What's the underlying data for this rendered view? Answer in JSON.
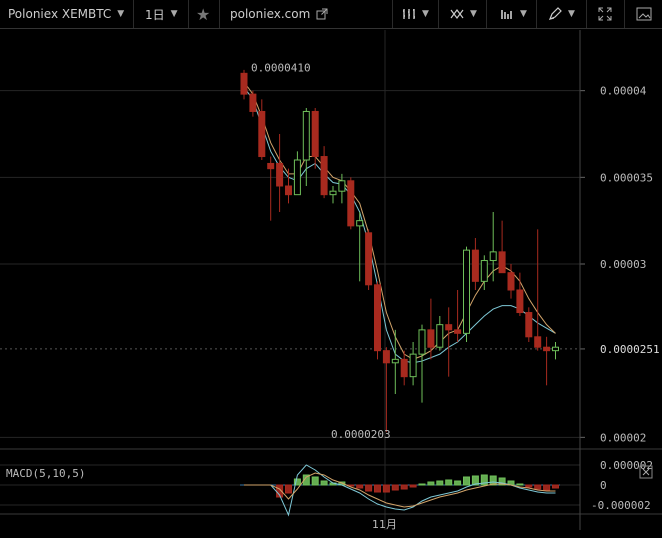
{
  "toolbar": {
    "symbol": "Poloniex XEMBTC",
    "interval": "1日",
    "source_link": "poloniex.com",
    "icons": [
      "star-icon",
      "external-link-icon",
      "bar-style-icon",
      "indicators-icon",
      "compare-icon",
      "draw-icon",
      "fullscreen-icon",
      "screenshot-icon"
    ]
  },
  "colors": {
    "up": "#6fbf5a",
    "down": "#a82a1f",
    "ma_fast": "#d2a46a",
    "ma_slow": "#7ec8d6",
    "grid": "#262626",
    "text": "#bbbbbb"
  },
  "price_labels": {
    "high": "0.0000410",
    "low": "0.0000203",
    "last": "0.0000251"
  },
  "macd": {
    "label": "MACD(5,10,5)"
  },
  "chart_data": [
    {
      "type": "candlestick",
      "title": "",
      "y_ticks": [
        "0.00002",
        "0.0000251",
        "0.00003",
        "0.000035",
        "0.00004"
      ],
      "ylim": [
        1.95e-05,
        4.35e-05
      ],
      "x_ticks": [
        "11月"
      ],
      "candles": [
        {
          "o": 4.1e-05,
          "h": 4.12e-05,
          "l": 3.95e-05,
          "c": 3.98e-05
        },
        {
          "o": 3.98e-05,
          "h": 4e-05,
          "l": 3.85e-05,
          "c": 3.88e-05
        },
        {
          "o": 3.88e-05,
          "h": 3.95e-05,
          "l": 3.6e-05,
          "c": 3.62e-05
        },
        {
          "o": 3.58e-05,
          "h": 3.62e-05,
          "l": 3.25e-05,
          "c": 3.55e-05
        },
        {
          "o": 3.58e-05,
          "h": 3.75e-05,
          "l": 3.3e-05,
          "c": 3.45e-05
        },
        {
          "o": 3.45e-05,
          "h": 3.55e-05,
          "l": 3.35e-05,
          "c": 3.4e-05
        },
        {
          "o": 3.4e-05,
          "h": 3.65e-05,
          "l": 3.4e-05,
          "c": 3.6e-05
        },
        {
          "o": 3.6e-05,
          "h": 3.9e-05,
          "l": 3.45e-05,
          "c": 3.88e-05
        },
        {
          "o": 3.88e-05,
          "h": 3.9e-05,
          "l": 3.55e-05,
          "c": 3.62e-05
        },
        {
          "o": 3.62e-05,
          "h": 3.68e-05,
          "l": 3.38e-05,
          "c": 3.4e-05
        },
        {
          "o": 3.4e-05,
          "h": 3.45e-05,
          "l": 3.35e-05,
          "c": 3.42e-05
        },
        {
          "o": 3.42e-05,
          "h": 3.52e-05,
          "l": 3.35e-05,
          "c": 3.48e-05
        },
        {
          "o": 3.48e-05,
          "h": 3.5e-05,
          "l": 3.2e-05,
          "c": 3.22e-05
        },
        {
          "o": 3.22e-05,
          "h": 3.3e-05,
          "l": 2.9e-05,
          "c": 3.25e-05
        },
        {
          "o": 3.18e-05,
          "h": 3.2e-05,
          "l": 2.85e-05,
          "c": 2.88e-05
        },
        {
          "o": 2.88e-05,
          "h": 2.9e-05,
          "l": 2.45e-05,
          "c": 2.5e-05
        },
        {
          "o": 2.5e-05,
          "h": 2.52e-05,
          "l": 2.03e-05,
          "c": 2.43e-05
        },
        {
          "o": 2.43e-05,
          "h": 2.62e-05,
          "l": 2.25e-05,
          "c": 2.45e-05
        },
        {
          "o": 2.45e-05,
          "h": 2.5e-05,
          "l": 2.3e-05,
          "c": 2.35e-05
        },
        {
          "o": 2.35e-05,
          "h": 2.55e-05,
          "l": 2.3e-05,
          "c": 2.48e-05
        },
        {
          "o": 2.48e-05,
          "h": 2.65e-05,
          "l": 2.2e-05,
          "c": 2.62e-05
        },
        {
          "o": 2.62e-05,
          "h": 2.8e-05,
          "l": 2.45e-05,
          "c": 2.52e-05
        },
        {
          "o": 2.52e-05,
          "h": 2.7e-05,
          "l": 2.5e-05,
          "c": 2.65e-05
        },
        {
          "o": 2.65e-05,
          "h": 2.75e-05,
          "l": 2.35e-05,
          "c": 2.62e-05
        },
        {
          "o": 2.62e-05,
          "h": 2.85e-05,
          "l": 2.55e-05,
          "c": 2.6e-05
        },
        {
          "o": 2.6e-05,
          "h": 3.1e-05,
          "l": 2.55e-05,
          "c": 3.08e-05
        },
        {
          "o": 3.08e-05,
          "h": 3.15e-05,
          "l": 2.85e-05,
          "c": 2.9e-05
        },
        {
          "o": 2.9e-05,
          "h": 3.05e-05,
          "l": 2.85e-05,
          "c": 3.02e-05
        },
        {
          "o": 3.02e-05,
          "h": 3.3e-05,
          "l": 2.9e-05,
          "c": 3.07e-05
        },
        {
          "o": 3.07e-05,
          "h": 3.25e-05,
          "l": 2.95e-05,
          "c": 2.95e-05
        },
        {
          "o": 2.95e-05,
          "h": 3e-05,
          "l": 2.8e-05,
          "c": 2.85e-05
        },
        {
          "o": 2.85e-05,
          "h": 2.95e-05,
          "l": 2.7e-05,
          "c": 2.72e-05
        },
        {
          "o": 2.72e-05,
          "h": 2.75e-05,
          "l": 2.55e-05,
          "c": 2.58e-05
        },
        {
          "o": 2.58e-05,
          "h": 3.2e-05,
          "l": 2.5e-05,
          "c": 2.52e-05
        },
        {
          "o": 2.52e-05,
          "h": 2.58e-05,
          "l": 2.3e-05,
          "c": 2.5e-05
        },
        {
          "o": 2.5e-05,
          "h": 2.55e-05,
          "l": 2.45e-05,
          "c": 2.52e-05
        }
      ],
      "ma_fast": [
        4.05e-05,
        3.98e-05,
        3.85e-05,
        3.7e-05,
        3.6e-05,
        3.52e-05,
        3.52e-05,
        3.62e-05,
        3.62e-05,
        3.56e-05,
        3.5e-05,
        3.48e-05,
        3.42e-05,
        3.35e-05,
        3.18e-05,
        2.96e-05,
        2.72e-05,
        2.58e-05,
        2.48e-05,
        2.45e-05,
        2.47e-05,
        2.5e-05,
        2.55e-05,
        2.6e-05,
        2.62e-05,
        2.72e-05,
        2.82e-05,
        2.9e-05,
        2.96e-05,
        2.99e-05,
        2.96e-05,
        2.9e-05,
        2.8e-05,
        2.72e-05,
        2.65e-05,
        2.6e-05
      ],
      "ma_slow": [
        4.02e-05,
        3.95e-05,
        3.8e-05,
        3.65e-05,
        3.56e-05,
        3.5e-05,
        3.48e-05,
        3.55e-05,
        3.58e-05,
        3.52e-05,
        3.47e-05,
        3.46e-05,
        3.4e-05,
        3.3e-05,
        3.12e-05,
        2.88e-05,
        2.62e-05,
        2.48e-05,
        2.44e-05,
        2.43e-05,
        2.44e-05,
        2.46e-05,
        2.48e-05,
        2.52e-05,
        2.55e-05,
        2.6e-05,
        2.65e-05,
        2.7e-05,
        2.74e-05,
        2.76e-05,
        2.76e-05,
        2.74e-05,
        2.7e-05,
        2.66e-05,
        2.63e-05,
        2.6e-05
      ]
    },
    {
      "type": "bar",
      "title": "MACD(5,10,5)",
      "y_ticks": [
        "0.000002",
        "0",
        "-0.000002"
      ],
      "ylim": [
        -2.7e-06,
        2.7e-06
      ],
      "histogram": [
        0,
        0,
        0,
        0,
        -1.2e-06,
        -8e-07,
        6e-07,
        1e-06,
        8e-07,
        4e-07,
        2e-07,
        3e-07,
        -1e-07,
        -3e-07,
        -6e-07,
        -7e-07,
        -7e-07,
        -5e-07,
        -4e-07,
        -2e-07,
        1e-07,
        3e-07,
        4e-07,
        5e-07,
        4e-07,
        8e-07,
        9e-07,
        1e-06,
        9e-07,
        7e-07,
        4e-07,
        1e-07,
        -2e-07,
        -4e-07,
        -5e-07,
        -3e-07
      ],
      "macd_line": [
        0,
        0,
        0,
        0,
        -1e-06,
        -3e-06,
        1e-06,
        2e-06,
        1.5e-06,
        8e-07,
        2e-07,
        0.0,
        -4e-07,
        -8e-07,
        -1.4e-06,
        -1.9e-06,
        -2.2e-06,
        -2.4e-06,
        -2.5e-06,
        -2.2e-06,
        -1.6e-06,
        -1.2e-06,
        -1e-06,
        -8e-07,
        -6e-07,
        -2e-07,
        1e-07,
        2e-07,
        3e-07,
        2e-07,
        0.0,
        -3e-07,
        -5e-07,
        -7e-07,
        -8e-07,
        -8e-07
      ],
      "signal_line": [
        0,
        0,
        0,
        0,
        -4e-07,
        -1.4e-06,
        -4e-07,
        8e-07,
        1.2e-06,
        1e-06,
        5e-07,
        2e-07,
        -2e-07,
        -5e-07,
        -1e-06,
        -1.4e-06,
        -1.8e-06,
        -2e-06,
        -2.2e-06,
        -2.1e-06,
        -1.8e-06,
        -1.5e-06,
        -1.2e-06,
        -1e-06,
        -8e-07,
        -5e-07,
        -3e-07,
        -1e-07,
        1e-07,
        1e-07,
        0.0,
        -2e-07,
        -3e-07,
        -5e-07,
        -6e-07,
        -6e-07
      ]
    }
  ]
}
